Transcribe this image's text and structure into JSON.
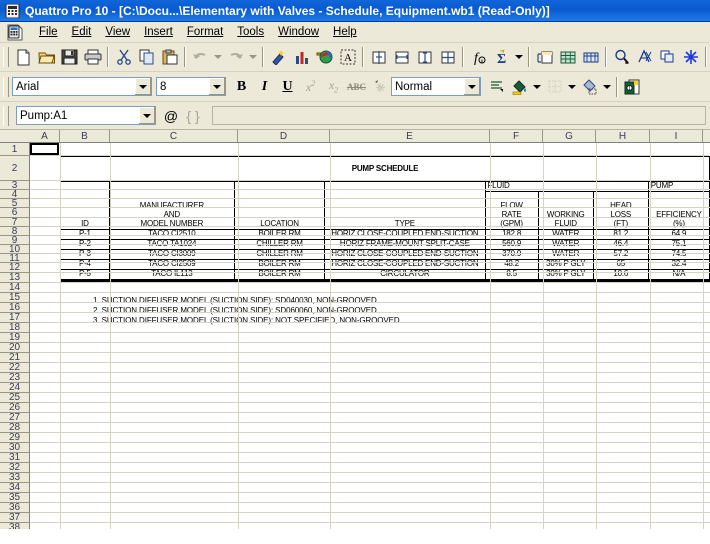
{
  "window": {
    "title": "Quattro Pro 10 - [C:\\Docu...\\Elementary with Valves - Schedule, Equipment.wb1 (Read-Only)]",
    "app_icon": "spreadsheet-icon"
  },
  "menubar": {
    "doc_icon": "document-icon",
    "items": [
      {
        "label": "File",
        "accel": "F"
      },
      {
        "label": "Edit",
        "accel": "E"
      },
      {
        "label": "View",
        "accel": "V"
      },
      {
        "label": "Insert",
        "accel": "I"
      },
      {
        "label": "Format",
        "accel": "o"
      },
      {
        "label": "Tools",
        "accel": "T"
      },
      {
        "label": "Window",
        "accel": "W"
      },
      {
        "label": "Help",
        "accel": "H"
      }
    ]
  },
  "toolbar_standard": {
    "buttons": [
      "new-icon",
      "open-icon",
      "save-icon",
      "print-icon",
      "cut-icon",
      "copy-icon",
      "paste-icon",
      "undo-icon",
      "undo-dropdown-icon",
      "redo-icon",
      "redo-dropdown-icon",
      "quickformat-icon",
      "chart-icon",
      "map-icon",
      "textbox-icon",
      "row-fit-icon",
      "column-fit-icon",
      "cell-fit-icon",
      "block-fit-icon",
      "function-icon",
      "sum-icon",
      "sum-dropdown-icon",
      "insert-cells-icon",
      "sheet-icon",
      "notebook-icon",
      "zoom-icon",
      "spell-icon",
      "duplicate-icon",
      "snowflake-icon",
      "move-icon"
    ]
  },
  "toolbar_format": {
    "font_name": "Arial",
    "font_size": "8",
    "style_name": "Normal",
    "buttons": [
      "bold-icon",
      "italic-icon",
      "underline-icon",
      "superscript-icon",
      "subscript-icon",
      "strikethrough-icon",
      "special-icon",
      "align-icon",
      "fill-color-icon",
      "fill-color-dropdown-icon",
      "border-icon",
      "border-dropdown-icon",
      "line-color-icon",
      "line-color-dropdown-icon",
      "properties-icon"
    ]
  },
  "formula_bar": {
    "cell_reference": "Pump:A1",
    "at_icon": "at-sign-icon",
    "braces_icon": "braces-icon",
    "input_value": ""
  },
  "sheet": {
    "columns": [
      "A",
      "B",
      "C",
      "D",
      "E",
      "F",
      "G",
      "H",
      "I"
    ],
    "rows": [
      1,
      2,
      3,
      4,
      5,
      6,
      7,
      8,
      9,
      10,
      11,
      12,
      13,
      14,
      15,
      16,
      17,
      18,
      19,
      20,
      21,
      22,
      23,
      24,
      25,
      26,
      27,
      28,
      29,
      30,
      31,
      32,
      33,
      34,
      35,
      36,
      37,
      38
    ],
    "active_cell": "A1"
  },
  "schedule": {
    "title": "PUMP SCHEDULE",
    "group_headers": {
      "fluid": "FLUID",
      "pump": "PUMP"
    },
    "headers": {
      "id": "ID",
      "manufacturer": [
        "MANUFACTURER",
        "AND",
        "MODEL NUMBER"
      ],
      "location": "LOCATION",
      "type": "TYPE",
      "flow_rate": [
        "FLOW",
        "RATE",
        "(GPM)"
      ],
      "working_fluid": [
        "",
        "WORKING",
        "FLUID"
      ],
      "head_loss": [
        "HEAD",
        "LOSS",
        "(FT)"
      ],
      "efficiency": [
        "",
        "EFFICIENCY",
        "(%)"
      ]
    },
    "rows": [
      {
        "id": "P-1",
        "model": "TACO CI2510",
        "location": "BOILER RM",
        "type": "HORIZ CLOSE-COUPLED END-SUCTION",
        "flow": "182.8",
        "fluid": "WATER",
        "head": "81.2",
        "eff": "64.9"
      },
      {
        "id": "P-2",
        "model": "TACO TA1024",
        "location": "CHILLER RM",
        "type": "HORIZ FRAME-MOUNT SPLIT-CASE",
        "flow": "560.9",
        "fluid": "WATER",
        "head": "46.4",
        "eff": "75.1"
      },
      {
        "id": "P-3",
        "model": "TACO CI3009",
        "location": "CHILLER RM",
        "type": "HORIZ CLOSE-COUPLED END-SUCTION",
        "flow": "370.9",
        "fluid": "WATER",
        "head": "57.2",
        "eff": "74.5"
      },
      {
        "id": "P-4",
        "model": "TACO CI2509",
        "location": "BOILER RM",
        "type": "HORIZ CLOSE-COUPLED END-SUCTION",
        "flow": "48.2",
        "fluid": "30% P GLY",
        "head": "65",
        "eff": "32.4"
      },
      {
        "id": "P-5",
        "model": "TACO IL113",
        "location": "BOILER RM",
        "type": "CIRCULATOR",
        "flow": "8.5",
        "fluid": "30% P GLY",
        "head": "10.6",
        "eff": "N/A"
      }
    ],
    "notes": [
      "1. SUCTION DIFFUSER MODEL (SUCTION SIDE): SD040030, NON-GROOVED",
      "2. SUCTION DIFFUSER MODEL (SUCTION SIDE): SD060060, NON-GROOVED",
      "3. SUCTION DIFFUSER MODEL (SUCTION SIDE): NOT SPECIFIED, NON-GROOVED"
    ]
  },
  "colors": {
    "titlebar": "#0a5ad0",
    "chrome": "#ece9d8",
    "grid_line": "#d8d4c4",
    "header_text": "#3b3b5c"
  }
}
